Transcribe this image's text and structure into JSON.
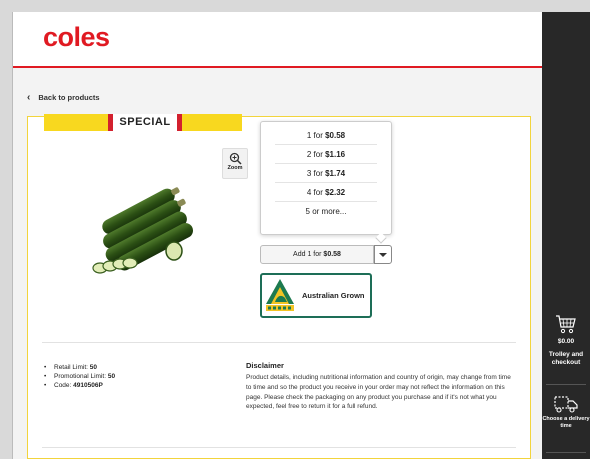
{
  "header": {
    "logo": "coles"
  },
  "nav": {
    "back_label": "Back to products"
  },
  "product": {
    "special_label": "SPECIAL",
    "zoom_label": "Zoom",
    "price_options": [
      {
        "qty": "1 for",
        "price": "$0.58"
      },
      {
        "qty": "2 for",
        "price": "$1.16"
      },
      {
        "qty": "3 for",
        "price": "$1.74"
      },
      {
        "qty": "4 for",
        "price": "$2.32"
      }
    ],
    "more_option": "5 or more...",
    "add_button": {
      "prefix": "Add 1 for",
      "price": "$0.58"
    },
    "badge_label": "Australian Grown"
  },
  "limits": {
    "retail_label": "Retail Limit:",
    "retail_value": "50",
    "promo_label": "Promotional Limit:",
    "promo_value": "50",
    "code_label": "Code:",
    "code_value": "4910506P"
  },
  "disclaimer": {
    "title": "Disclaimer",
    "text": "Product details, including nutritional information and country of origin, may change from time to time and so the product you receive in your order may not reflect the information on this page. Please check the packaging on any product you purchase and if it's not what you expected, feel free to return it for a full refund."
  },
  "sidebar": {
    "trolley_amount": "$0.00",
    "trolley_label": "Trolley and checkout",
    "delivery_label": "Choose a delivery time"
  },
  "colors": {
    "brand": "#e01a22",
    "special_yellow": "#f8d81f",
    "badge_green": "#1d6e57",
    "panel_dark": "#282828"
  },
  "icons": [
    "chevron-left-icon",
    "zoom-in-icon",
    "chevron-down-icon",
    "australian-grown-kangaroo-icon",
    "trolley-icon",
    "delivery-truck-icon"
  ]
}
